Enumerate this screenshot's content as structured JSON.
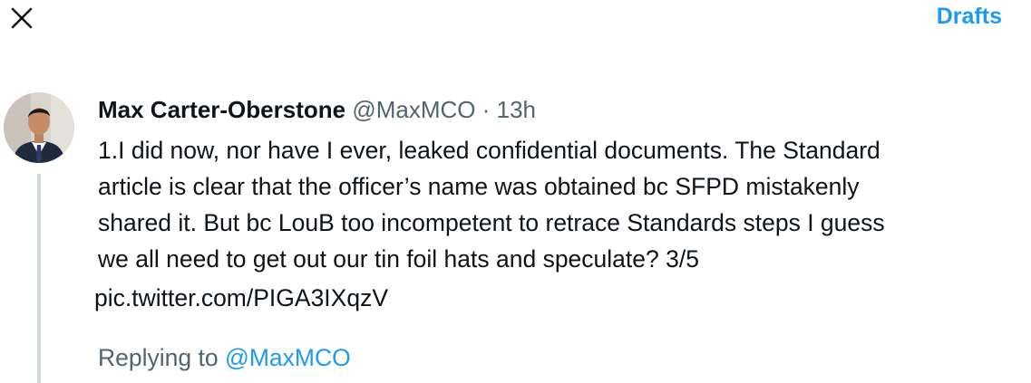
{
  "header": {
    "close_icon": "close-icon",
    "drafts_label": "Drafts"
  },
  "colors": {
    "accent": "#1d9bf0",
    "secondary_text": "#536471",
    "primary_text": "#0f1419",
    "thread_line": "#cfd9de"
  },
  "tweet": {
    "author_name": "Max Carter-Oberstone",
    "handle": "@MaxMCO",
    "separator": "·",
    "time": "13h",
    "body": "1.I did now, nor have I ever, leaked confidential documents. The Standard\narticle is clear that the officer’s name was obtained bc SFPD mistakenly\nshared it. But bc LouB too incompetent to retrace Standards steps I guess\nwe all need to get out our tin foil hats and speculate? 3/5",
    "link": "pic.twitter.com/PIGA3IXqzV",
    "replying_prefix": "Replying to",
    "replying_to": "@MaxMCO"
  }
}
